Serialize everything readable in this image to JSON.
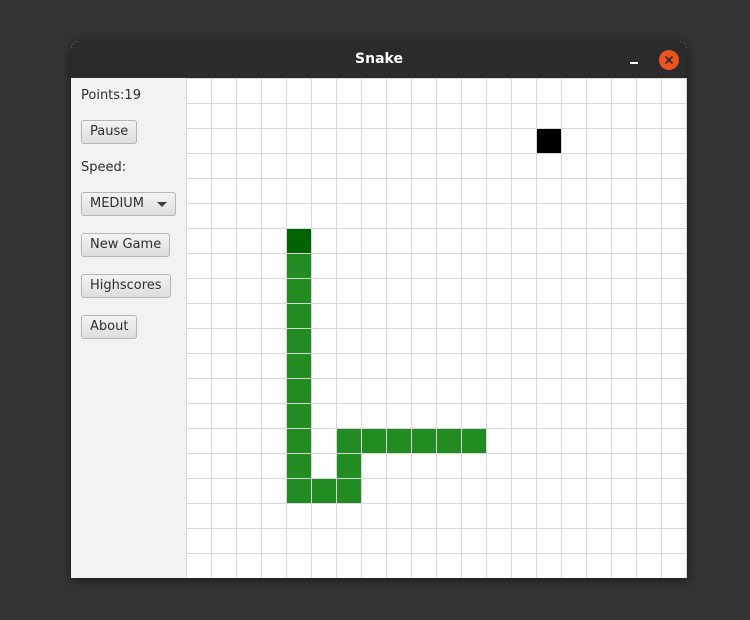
{
  "window": {
    "title": "Snake"
  },
  "sidebar": {
    "points_text": "Points:19",
    "pause_label": "Pause",
    "speed_label": "Speed:",
    "speed_selected": "MEDIUM",
    "new_game_label": "New Game",
    "highscores_label": "Highscores",
    "about_label": "About"
  },
  "board": {
    "columns": 20,
    "rows": 20,
    "colors": {
      "snake_head": "#006400",
      "snake_body": "#228b22",
      "food": "#000000",
      "grid": "#d8d8d8"
    },
    "food": [
      14,
      2
    ],
    "snake": [
      [
        4,
        6
      ],
      [
        4,
        7
      ],
      [
        4,
        8
      ],
      [
        4,
        9
      ],
      [
        4,
        10
      ],
      [
        4,
        11
      ],
      [
        4,
        12
      ],
      [
        4,
        13
      ],
      [
        4,
        14
      ],
      [
        4,
        15
      ],
      [
        4,
        16
      ],
      [
        5,
        16
      ],
      [
        6,
        16
      ],
      [
        6,
        15
      ],
      [
        6,
        14
      ],
      [
        7,
        14
      ],
      [
        8,
        14
      ],
      [
        9,
        14
      ],
      [
        10,
        14
      ],
      [
        11,
        14
      ]
    ]
  }
}
